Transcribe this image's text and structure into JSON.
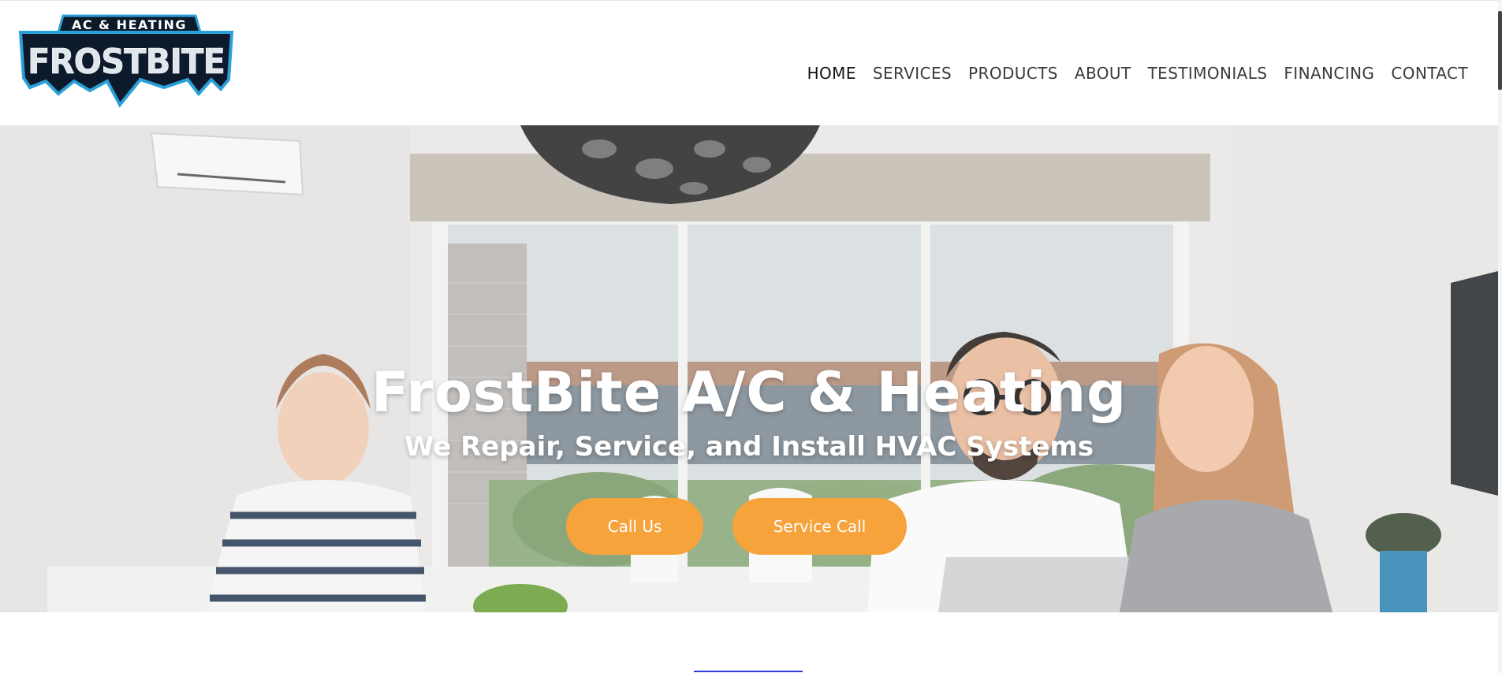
{
  "brand": {
    "logo_top": "AC & HEATING",
    "logo_main": "FROSTBITE",
    "colors": {
      "logo_blue": "#2aa0d8",
      "logo_dark": "#0d1a2b",
      "accent_orange": "#f7a33c"
    }
  },
  "nav": {
    "items": [
      {
        "label": "HOME",
        "active": true
      },
      {
        "label": "SERVICES"
      },
      {
        "label": "PRODUCTS"
      },
      {
        "label": "ABOUT"
      },
      {
        "label": "TESTIMONIALS"
      },
      {
        "label": "FINANCING"
      },
      {
        "label": "CONTACT"
      }
    ]
  },
  "hero": {
    "title": "FrostBite A/C & Heating",
    "subtitle": "We Repair, Service, and Install HVAC Systems",
    "buttons": {
      "call": "Call Us",
      "service": "Service Call"
    },
    "background": "family-living-room-photo"
  }
}
